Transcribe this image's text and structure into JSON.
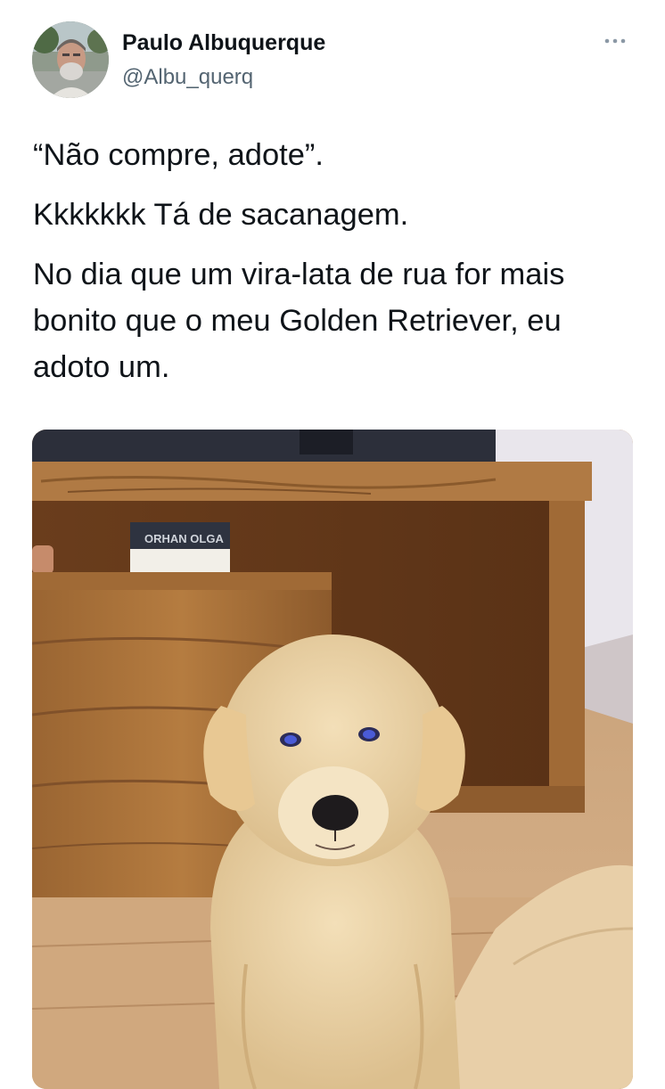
{
  "tweet": {
    "author": {
      "name": "Paulo Albuquerque",
      "handle": "@Albu_querq"
    },
    "more_icon": "more-horizontal-icon",
    "text": {
      "line1": "“Não compre, adote”.",
      "line2": "Kkkkkkk Tá de sacanagem.",
      "line3": "No dia que um vira-lata de rua for mais bonito que o meu Golden Retriever, eu adoto um."
    },
    "media": {
      "type": "photo",
      "book_spine_text": "ORHAN OLGA"
    }
  },
  "colors": {
    "text_primary": "#0f1419",
    "text_secondary": "#536471",
    "background": "#ffffff"
  }
}
